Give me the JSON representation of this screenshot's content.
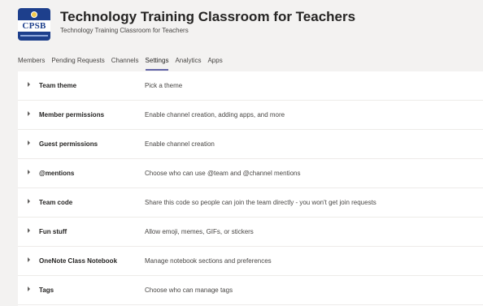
{
  "team": {
    "logo_text": "CPSB",
    "title": "Technology Training Classroom for Teachers",
    "subtitle": "Technology Training Classroom for Teachers",
    "more_icon": "ellipsis-icon"
  },
  "tabs": [
    {
      "label": "Members",
      "active": false
    },
    {
      "label": "Pending Requests",
      "active": false
    },
    {
      "label": "Channels",
      "active": false
    },
    {
      "label": "Settings",
      "active": true
    },
    {
      "label": "Analytics",
      "active": false
    },
    {
      "label": "Apps",
      "active": false
    }
  ],
  "settings": [
    {
      "name": "Team theme",
      "description": "Pick a theme"
    },
    {
      "name": "Member permissions",
      "description": "Enable channel creation, adding apps, and more"
    },
    {
      "name": "Guest permissions",
      "description": "Enable channel creation"
    },
    {
      "name": "@mentions",
      "description": "Choose who can use @team and @channel mentions"
    },
    {
      "name": "Team code",
      "description": "Share this code so people can join the team directly - you won't get join requests"
    },
    {
      "name": "Fun stuff",
      "description": "Allow emoji, memes, GIFs, or stickers"
    },
    {
      "name": "OneNote Class Notebook",
      "description": "Manage notebook sections and preferences"
    },
    {
      "name": "Tags",
      "description": "Choose who can manage tags"
    }
  ],
  "colors": {
    "accent": "#6264a7",
    "background": "#f3f2f1",
    "panel": "#ffffff",
    "logo": "#1d3f8c"
  }
}
